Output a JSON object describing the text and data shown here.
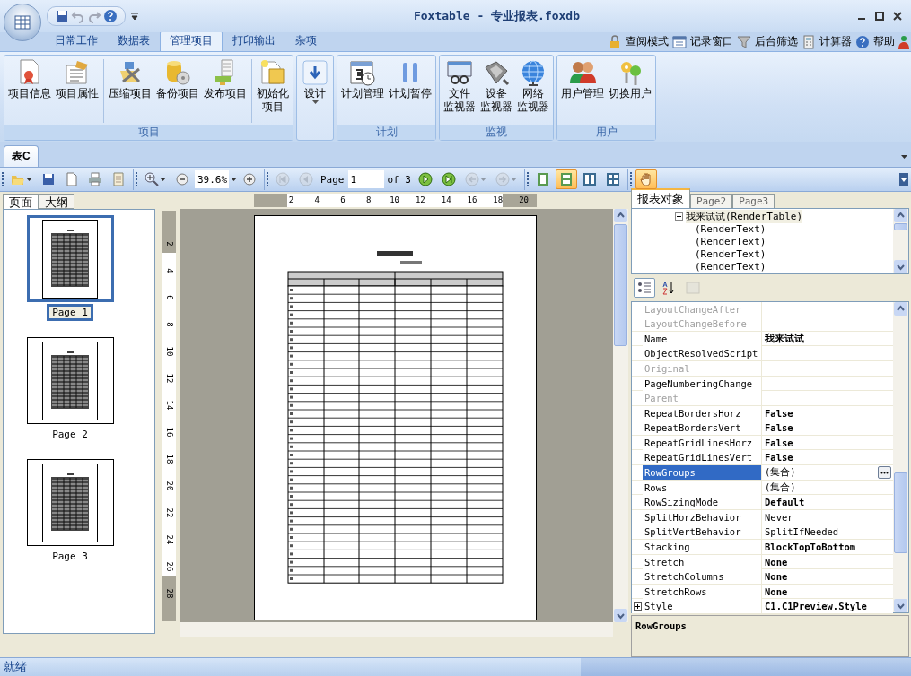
{
  "window": {
    "title": "Foxtable - 专业报表.foxdb"
  },
  "quick_access": [
    {
      "disabled": false
    },
    {
      "disabled": true
    },
    {
      "disabled": true
    },
    {
      "disabled": false
    }
  ],
  "ribbon_tabs": [
    {
      "label": "日常工作",
      "selected": false
    },
    {
      "label": "数据表",
      "selected": false
    },
    {
      "label": "管理项目",
      "selected": true
    },
    {
      "label": "打印输出",
      "selected": false
    },
    {
      "label": "杂项",
      "selected": false
    }
  ],
  "ribbon_links": [
    {
      "label": "查阅模式"
    },
    {
      "label": "记录窗口"
    },
    {
      "label": "后台筛选"
    },
    {
      "label": "计算器"
    },
    {
      "label": "帮助"
    }
  ],
  "ribbon_groups": [
    {
      "label": "项目",
      "buttons": [
        {
          "lines": [
            "项目信息"
          ]
        },
        {
          "lines": [
            "项目属性"
          ]
        },
        {
          "lines": [
            "压缩项目"
          ]
        },
        {
          "lines": [
            "备份项目"
          ]
        },
        {
          "lines": [
            "发布项目"
          ]
        },
        {
          "lines": [
            "初始化",
            "项目"
          ]
        }
      ]
    },
    {
      "buttons": [
        {
          "lines": [
            "设计"
          ],
          "dropdown": true
        }
      ]
    },
    {
      "label": "计划",
      "buttons": [
        {
          "lines": [
            "计划管理"
          ]
        },
        {
          "lines": [
            "计划暂停"
          ]
        }
      ]
    },
    {
      "label": "监视",
      "buttons": [
        {
          "lines": [
            "文件",
            "监视器"
          ]
        },
        {
          "lines": [
            "设备",
            "监视器"
          ]
        },
        {
          "lines": [
            "网络",
            "监视器"
          ]
        }
      ]
    },
    {
      "label": "用户",
      "buttons": [
        {
          "lines": [
            "用户管理"
          ]
        },
        {
          "lines": [
            "切换用户"
          ]
        }
      ]
    }
  ],
  "document_tabs": [
    {
      "label": "表C",
      "selected": true
    }
  ],
  "toolbar": {
    "groups": [
      [
        {
          "kind": "button",
          "dropdown": true,
          "disabled": false,
          "selected": false
        },
        {
          "kind": "button",
          "disabled": false,
          "selected": false
        },
        {
          "kind": "button",
          "disabled": false,
          "selected": false
        },
        {
          "kind": "button",
          "disabled": false,
          "selected": false
        },
        {
          "kind": "button",
          "disabled": false,
          "selected": false
        }
      ],
      [
        {
          "kind": "button",
          "dropdown": true,
          "disabled": false,
          "selected": false
        },
        {
          "kind": "button",
          "disabled": false,
          "selected": false
        },
        {
          "kind": "field",
          "value": "39.6%",
          "dropdown": true
        },
        {
          "kind": "button",
          "disabled": false,
          "selected": false
        }
      ],
      [
        {
          "kind": "button",
          "disabled": true,
          "selected": false
        },
        {
          "kind": "button",
          "disabled": true,
          "selected": false
        },
        {
          "kind": "label",
          "text": "Page"
        },
        {
          "kind": "field",
          "value": "1"
        },
        {
          "kind": "label",
          "text": "of 3"
        },
        {
          "kind": "button",
          "disabled": false,
          "selected": false
        },
        {
          "kind": "button",
          "disabled": false,
          "selected": false
        },
        {
          "kind": "button",
          "dropdown": true,
          "disabled": true,
          "selected": false
        },
        {
          "kind": "button",
          "dropdown": true,
          "disabled": true,
          "selected": false
        }
      ],
      [
        {
          "kind": "button",
          "disabled": false,
          "selected": false
        },
        {
          "kind": "button",
          "disabled": false,
          "selected": true
        },
        {
          "kind": "button",
          "disabled": false,
          "selected": false
        },
        {
          "kind": "button",
          "disabled": false,
          "selected": false
        }
      ],
      [
        {
          "kind": "button",
          "disabled": false,
          "selected": true
        }
      ]
    ]
  },
  "left_panel": {
    "tabs": [
      {
        "label": "页面",
        "selected": true
      },
      {
        "label": "大纲",
        "selected": false
      }
    ],
    "thumbnails": [
      {
        "label": "Page 1",
        "selected": true
      },
      {
        "label": "Page 2",
        "selected": false
      },
      {
        "label": "Page 3",
        "selected": false
      }
    ]
  },
  "rulers": {
    "horizontal": [
      "2",
      "4",
      "6",
      "8",
      "10",
      "12",
      "14",
      "16",
      "18",
      "20"
    ],
    "vertical": [
      "2",
      "4",
      "6",
      "8",
      "10",
      "12",
      "14",
      "16",
      "18",
      "20",
      "22",
      "24",
      "26",
      "28"
    ]
  },
  "object_tabs": [
    {
      "label": "报表对象",
      "selected": true
    },
    {
      "label": "Page2",
      "selected": false
    },
    {
      "label": "Page3",
      "selected": false
    }
  ],
  "tree": {
    "label": "我来试试(RenderTable)",
    "expanded": true,
    "children": [
      {
        "label": "(RenderText)"
      },
      {
        "label": "(RenderText)"
      },
      {
        "label": "(RenderText)"
      },
      {
        "label": "(RenderText)"
      }
    ]
  },
  "property_grid": {
    "rows": [
      {
        "kind": "text",
        "name": "LayoutChangeAfter",
        "disabled": true,
        "selected": false
      },
      {
        "kind": "text",
        "name": "LayoutChangeBefore",
        "disabled": true,
        "selected": false
      },
      {
        "kind": "text",
        "name": "Name",
        "value": "我来试试",
        "bold": true,
        "disabled": false,
        "selected": false
      },
      {
        "kind": "text",
        "name": "ObjectResolvedScript",
        "disabled": false,
        "selected": false
      },
      {
        "kind": "text",
        "name": "Original",
        "disabled": true,
        "selected": false
      },
      {
        "kind": "text",
        "name": "PageNumberingChange",
        "disabled": false,
        "selected": false
      },
      {
        "kind": "text",
        "name": "Parent",
        "disabled": true,
        "selected": false
      },
      {
        "kind": "text",
        "name": "RepeatBordersHorz",
        "value": "False",
        "bold": true,
        "disabled": false,
        "selected": false
      },
      {
        "kind": "text",
        "name": "RepeatBordersVert",
        "value": "False",
        "bold": true,
        "disabled": false,
        "selected": false
      },
      {
        "kind": "text",
        "name": "RepeatGridLinesHorz",
        "value": "False",
        "bold": true,
        "disabled": false,
        "selected": false
      },
      {
        "kind": "text",
        "name": "RepeatGridLinesVert",
        "value": "False",
        "bold": true,
        "disabled": false,
        "selected": false
      },
      {
        "kind": "collection",
        "name": "RowGroups",
        "value": "(集合)",
        "bold": false,
        "disabled": false,
        "selected": true
      },
      {
        "kind": "collection",
        "name": "Rows",
        "value": "(集合)",
        "bold": false,
        "disabled": false,
        "selected": false
      },
      {
        "kind": "text",
        "name": "RowSizingMode",
        "value": "Default",
        "bold": true,
        "disabled": false,
        "selected": false
      },
      {
        "kind": "text",
        "name": "SplitHorzBehavior",
        "value": "Never",
        "bold": false,
        "disabled": false,
        "selected": false
      },
      {
        "kind": "text",
        "name": "SplitVertBehavior",
        "value": "SplitIfNeeded",
        "bold": false,
        "disabled": false,
        "selected": false
      },
      {
        "kind": "text",
        "name": "Stacking",
        "value": "BlockTopToBottom",
        "bold": true,
        "disabled": false,
        "selected": false
      },
      {
        "kind": "text",
        "name": "Stretch",
        "value": "None",
        "bold": true,
        "disabled": false,
        "selected": false
      },
      {
        "kind": "text",
        "name": "StretchColumns",
        "value": "None",
        "bold": true,
        "disabled": false,
        "selected": false
      },
      {
        "kind": "text",
        "name": "StretchRows",
        "value": "None",
        "bold": true,
        "disabled": false,
        "selected": false
      },
      {
        "kind": "object",
        "name": "Style",
        "value": "C1.C1Preview.Style",
        "bold": true,
        "disabled": false,
        "selected": false
      }
    ]
  },
  "description": "RowGroups",
  "status_bar": {
    "text": "就绪"
  }
}
